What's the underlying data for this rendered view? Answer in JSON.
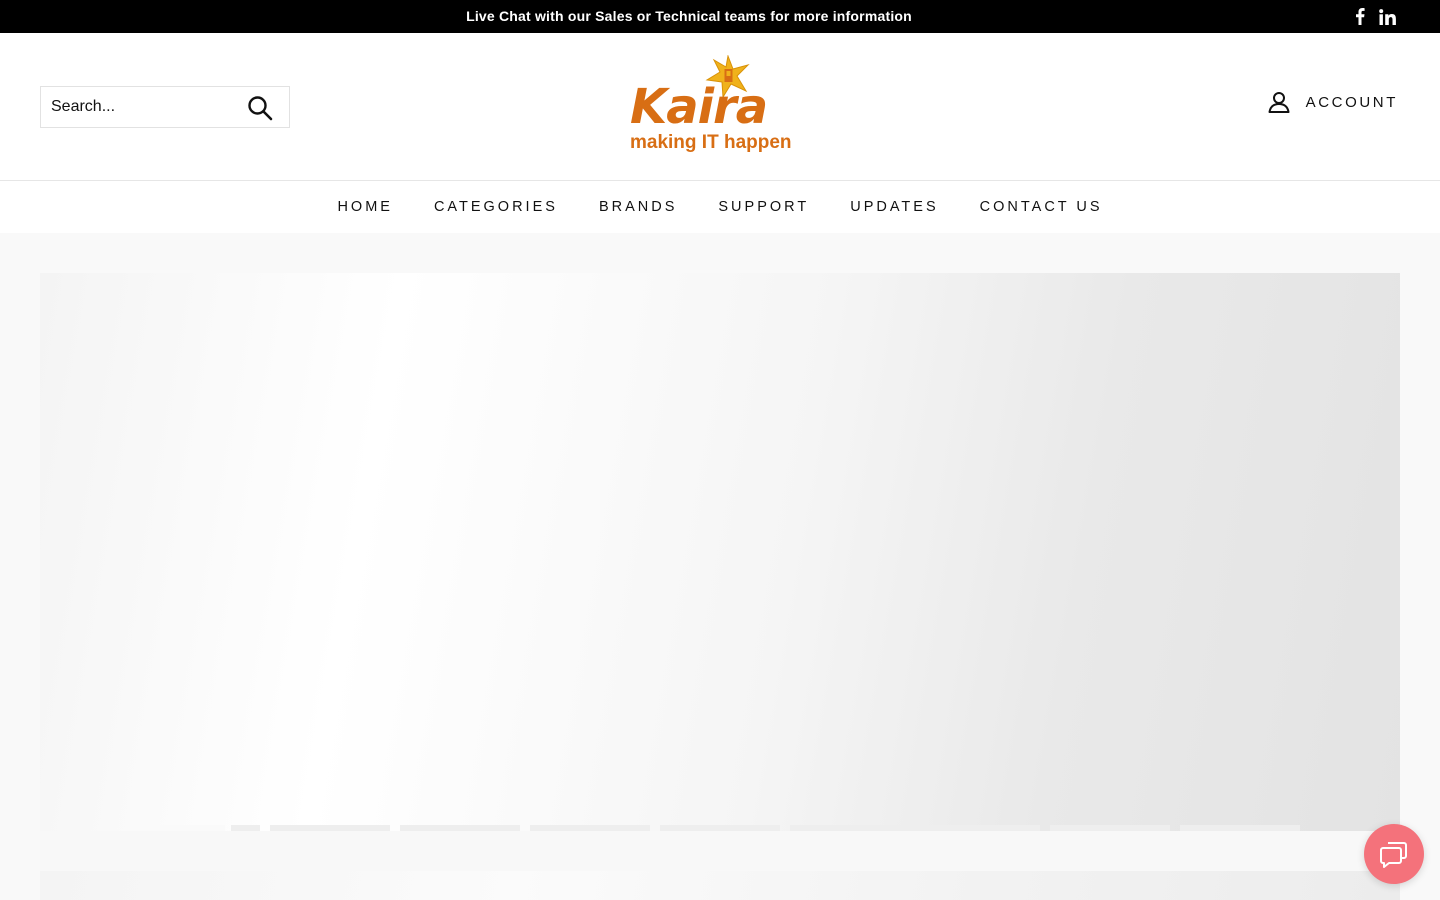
{
  "announcement": {
    "text": "Live Chat with our Sales or Technical teams for more information",
    "social": [
      {
        "name": "facebook-icon"
      },
      {
        "name": "linkedin-icon"
      }
    ]
  },
  "header": {
    "search": {
      "placeholder": "Search..."
    },
    "logo": {
      "wordmark": "Kaira",
      "tagline": "making IT happen"
    },
    "account": {
      "label": "ACCOUNT"
    }
  },
  "nav": {
    "items": [
      {
        "label": "HOME"
      },
      {
        "label": "CATEGORIES"
      },
      {
        "label": "BRANDS"
      },
      {
        "label": "SUPPORT"
      },
      {
        "label": "UPDATES"
      },
      {
        "label": "CONTACT US"
      }
    ]
  },
  "colors": {
    "announcement_bg": "#000000",
    "brand_orange": "#d86e14",
    "logo_star": "#f0b21b",
    "chat_button": "#f4727b"
  },
  "icons": {
    "search": "search-icon",
    "account": "user-icon",
    "chat": "chat-icon"
  }
}
